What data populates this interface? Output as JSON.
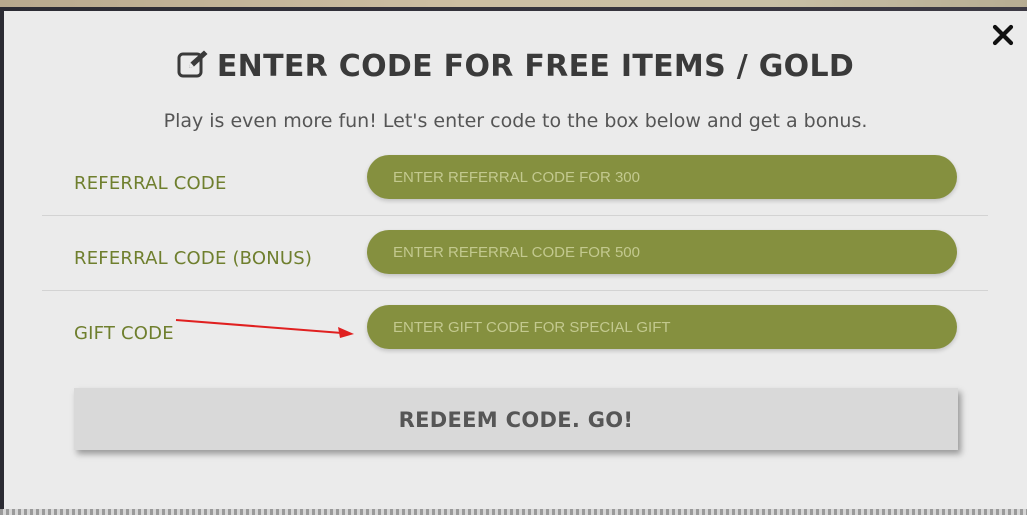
{
  "modal": {
    "title": "ENTER CODE FOR FREE ITEMS / GOLD",
    "subtitle": "Play is even more fun! Let's enter code to the box below and get a bonus.",
    "title_icon": "edit-icon",
    "close_icon": "close-icon"
  },
  "rows": [
    {
      "label": "REFERRAL CODE",
      "placeholder": "ENTER REFERRAL CODE FOR 300",
      "value": ""
    },
    {
      "label": "REFERRAL CODE (BONUS)",
      "placeholder": "ENTER REFERRAL CODE FOR 500",
      "value": ""
    },
    {
      "label": "GIFT CODE",
      "placeholder": "ENTER GIFT CODE FOR SPECIAL GIFT",
      "value": ""
    }
  ],
  "redeem_label": "REDEEM CODE. GO!",
  "colors": {
    "accent_green": "#85903f",
    "label_green": "#6f7f2e",
    "modal_bg": "#ebebeb",
    "annotation_arrow": "#e02020"
  }
}
